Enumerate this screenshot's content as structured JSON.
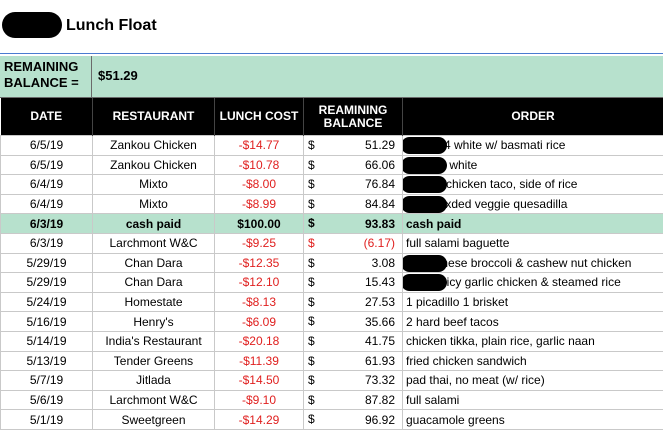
{
  "title": "Lunch Float",
  "balance": {
    "label_line1": "REMAINING",
    "label_line2": "BALANCE =",
    "value": "$51.29"
  },
  "headers": {
    "date": "DATE",
    "restaurant": "RESTAURANT",
    "lunch_cost": "LUNCH COST",
    "balance_line1": "REAMINING",
    "balance_line2": "BALANCE",
    "order": "ORDER"
  },
  "colors": {
    "accent_green": "#b7e1cd",
    "negative_red": "#e0201f",
    "header_black": "#000000"
  },
  "rows": [
    {
      "date": "6/5/19",
      "restaurant": "Zankou Chicken",
      "cost": "-$14.77",
      "dollar": "$",
      "balance": "51.29",
      "order": "1/4 white w/ basmati rice"
    },
    {
      "date": "6/5/19",
      "restaurant": "Zankou Chicken",
      "cost": "-$10.78",
      "dollar": "$",
      "balance": "66.06",
      "order": "/4 white"
    },
    {
      "date": "6/4/19",
      "restaurant": "Mixto",
      "cost": "-$8.00",
      "dollar": "$",
      "balance": "76.84",
      "order": "1 chicken taco, side of rice"
    },
    {
      "date": "6/4/19",
      "restaurant": "Mixto",
      "cost": "-$8.99",
      "dollar": "$",
      "balance": "84.84",
      "order": "nixded veggie quesadilla"
    },
    {
      "date": "6/3/19",
      "restaurant": "cash paid",
      "cost": "$100.00",
      "dollar": "$",
      "balance": "93.83",
      "order": "cash paid"
    },
    {
      "date": "6/3/19",
      "restaurant": "Larchmont W&C",
      "cost": "-$9.25",
      "dollar": "$",
      "balance": "(6.17)",
      "order": "full salami baguette"
    },
    {
      "date": "5/29/19",
      "restaurant": "Chan Dara",
      "cost": "-$12.35",
      "dollar": "$",
      "balance": "3.08",
      "order": "hinese broccoli & cashew nut chicken"
    },
    {
      "date": "5/29/19",
      "restaurant": "Chan Dara",
      "cost": "-$12.10",
      "dollar": "$",
      "balance": "15.43",
      "order": "spicy garlic chicken & steamed rice"
    },
    {
      "date": "5/24/19",
      "restaurant": "Homestate",
      "cost": "-$8.13",
      "dollar": "$",
      "balance": "27.53",
      "order": "1 picadillo 1 brisket"
    },
    {
      "date": "5/16/19",
      "restaurant": "Henry's",
      "cost": "-$6.09",
      "dollar": "$",
      "balance": "35.66",
      "order": "2 hard beef tacos"
    },
    {
      "date": "5/14/19",
      "restaurant": "India's Restaurant",
      "cost": "-$20.18",
      "dollar": "$",
      "balance": "41.75",
      "order": "chicken tikka, plain rice, garlic naan"
    },
    {
      "date": "5/13/19",
      "restaurant": "Tender Greens",
      "cost": "-$11.39",
      "dollar": "$",
      "balance": "61.93",
      "order": "fried chicken sandwich"
    },
    {
      "date": "5/7/19",
      "restaurant": "Jitlada",
      "cost": "-$14.50",
      "dollar": "$",
      "balance": "73.32",
      "order": "pad thai, no meat (w/ rice)"
    },
    {
      "date": "5/6/19",
      "restaurant": "Larchmont W&C",
      "cost": "-$9.10",
      "dollar": "$",
      "balance": "87.82",
      "order": "full salami"
    },
    {
      "date": "5/1/19",
      "restaurant": "Sweetgreen",
      "cost": "-$14.29",
      "dollar": "$",
      "balance": "96.92",
      "order": "guacamole greens"
    }
  ]
}
